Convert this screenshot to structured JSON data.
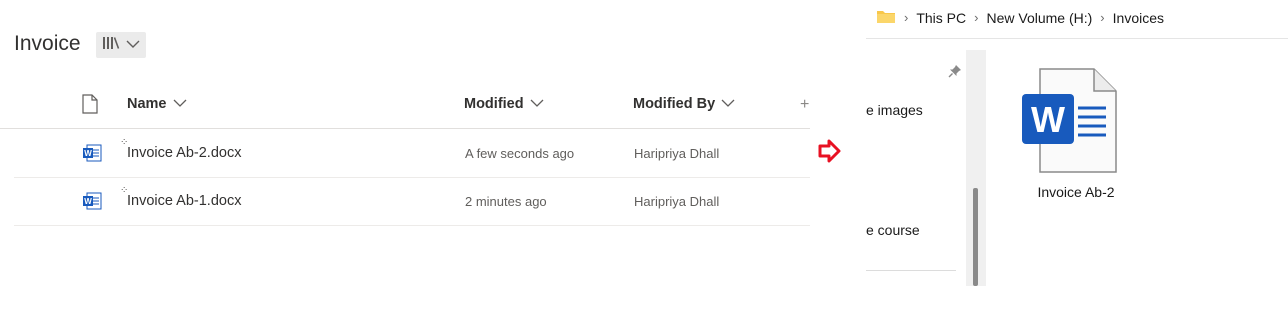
{
  "sharepoint": {
    "title": "Invoice",
    "columns": {
      "name": "Name",
      "modified": "Modified",
      "modified_by": "Modified By",
      "add": "+"
    },
    "rows": [
      {
        "name": "Invoice Ab-2.docx",
        "modified": "A few seconds ago",
        "modified_by": "Haripriya Dhall"
      },
      {
        "name": "Invoice Ab-1.docx",
        "modified": "2 minutes ago",
        "modified_by": "Haripriya Dhall"
      }
    ]
  },
  "explorer": {
    "breadcrumb": [
      "This PC",
      "New Volume (H:)",
      "Invoices"
    ],
    "nav_items": [
      "e images",
      "e course"
    ],
    "file": {
      "label": "Invoice Ab-2"
    }
  },
  "colors": {
    "word_blue": "#185abd",
    "arrow_red": "#e81123",
    "folder_yellow": "#f8c74a"
  },
  "icons": [
    "library-view-icon",
    "document-icon",
    "word-file-icon",
    "folder-icon",
    "pin-icon",
    "arrow-right-icon"
  ]
}
